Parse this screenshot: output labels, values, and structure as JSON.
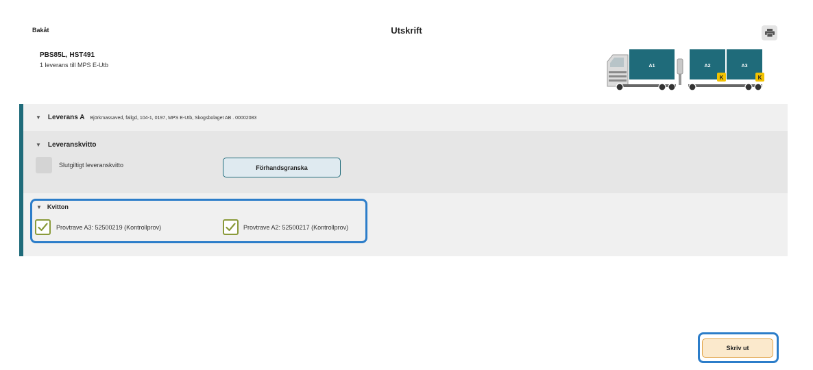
{
  "header": {
    "back_label": "Bakåt",
    "title": "Utskrift",
    "print_icon": "printer-icon"
  },
  "vehicle": {
    "registration": "PBS85L, HST491",
    "delivery_summary": "1 leverans till MPS E-Utb"
  },
  "truck": {
    "loads": [
      {
        "label": "A1",
        "badge": ""
      },
      {
        "label": "A2",
        "badge": "K"
      },
      {
        "label": "A3",
        "badge": "K"
      }
    ],
    "load_color": "#1f6b7a",
    "badge_color": "#f2c200"
  },
  "delivery": {
    "label": "Leverans A",
    "details": "Björkmassaved, fallgd, 104-1, 0197, MPS E-Utb, Skogsbolaget AB . 00002083"
  },
  "receipt": {
    "section_label": "Leveranskvitto",
    "final_checkbox_label": "Slutgiltigt leveranskvitto",
    "final_checked": false,
    "preview_button": "Förhandsgranska"
  },
  "kvitton": {
    "section_label": "Kvitton",
    "items": [
      {
        "label": "Provtrave A3: 52500219 (Kontrollprov)",
        "checked": true
      },
      {
        "label": "Provtrave A2: 52500217 (Kontrollprov)",
        "checked": true
      }
    ]
  },
  "footer": {
    "submit_button": "Skriv ut"
  },
  "colors": {
    "accent": "#1f6b7a",
    "highlight": "#2c7dc9",
    "check_green": "#8a9a3a",
    "submit_bg": "#fbe9cc"
  }
}
